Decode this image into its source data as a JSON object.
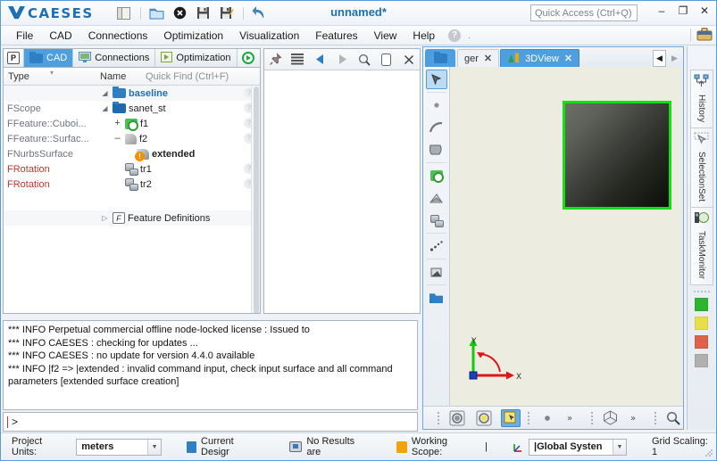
{
  "window": {
    "title": "unnamed*",
    "quick_access_placeholder": "Quick Access (Ctrl+Q)",
    "minimize": "–",
    "maximize": "❐",
    "close": "✕"
  },
  "toolbar": {
    "items": [
      {
        "name": "panel-layout-icon",
        "label": ""
      },
      {
        "name": "open-folder-icon",
        "label": ""
      },
      {
        "name": "close-project-icon",
        "label": ""
      },
      {
        "name": "save-icon",
        "label": ""
      },
      {
        "name": "save-as-icon",
        "label": ""
      },
      {
        "name": "undo-icon",
        "label": ""
      }
    ]
  },
  "menubar": {
    "items": [
      "File",
      "CAD",
      "Connections",
      "Optimization",
      "Visualization",
      "Features",
      "View",
      "Help"
    ],
    "help_glyph": "?",
    "trailing_dot": "."
  },
  "tree_panel": {
    "tabs": [
      {
        "label": "P",
        "name": "tab-p",
        "active": false
      },
      {
        "label": "CAD",
        "name": "tab-cad",
        "active": true
      },
      {
        "label": "Connections",
        "name": "tab-connections",
        "active": false
      },
      {
        "label": "Optimization",
        "name": "tab-optimization",
        "active": false
      }
    ],
    "columns": {
      "type": "Type",
      "name": "Name",
      "find_placeholder": "Quick Find (Ctrl+F)"
    },
    "rows": [
      {
        "type": "",
        "label": "baseline",
        "twisty": "◢",
        "icon": "folder-icon",
        "style": "blue",
        "help": true,
        "indent": 2,
        "alt": true
      },
      {
        "type": "FScope",
        "label": "sanet_st",
        "twisty": "◢",
        "icon": "folder-dark-icon",
        "style": "plain",
        "help": true,
        "indent": 2,
        "alt": false
      },
      {
        "type": "FFeature::Cuboi...",
        "label": "f1",
        "twisty": "+",
        "icon": "feature-green-icon",
        "style": "plain",
        "help": true,
        "indent": 3,
        "alt": false
      },
      {
        "type": "FFeature::Surfac...",
        "label": "f2",
        "twisty": "–",
        "icon": "surface-gray-icon",
        "style": "plain",
        "help": true,
        "indent": 3,
        "alt": false
      },
      {
        "type": "FNurbsSurface",
        "label": "extended",
        "twisty": "",
        "icon": "surface-warning-icon",
        "style": "plain",
        "help": false,
        "indent": 4,
        "alt": false
      },
      {
        "type": "FRotation",
        "label": "tr1",
        "twisty": "",
        "icon": "rotation-icon",
        "style": "red-type",
        "help": true,
        "indent": 4,
        "alt": false
      },
      {
        "type": "FRotation",
        "label": "tr2",
        "twisty": "",
        "icon": "rotation-icon",
        "style": "red-type",
        "help": true,
        "indent": 4,
        "alt": false
      },
      {
        "type": "",
        "label": "Feature Definitions",
        "twisty": "▷",
        "icon": "feature-definitions-icon",
        "style": "plain",
        "help": false,
        "indent": 3,
        "alt": true
      }
    ]
  },
  "prop_panel": {
    "toolbar_icons": [
      "pin-icon",
      "list-icon",
      "back-arrow-icon",
      "forward-arrow-icon",
      "search-icon",
      "copy-icon",
      "close-icon"
    ]
  },
  "log": {
    "lines": [
      "*** INFO Perpetual commercial offline node-locked license : Issued to",
      "*** INFO CAESES : checking for updates ...",
      "*** INFO CAESES : no update for version 4.4.0 available",
      "*** INFO |f2 => |extended : invalid command input, check input surface and all command parameters [extended surface creation]"
    ],
    "prompt": ">"
  },
  "view": {
    "tabs": [
      {
        "label": "ɡer",
        "name": "tab-manager",
        "active": false,
        "close": "✕"
      },
      {
        "label": "3DView",
        "name": "tab-3dview",
        "active": true,
        "close": "✕"
      }
    ],
    "nav_prev": "◀",
    "nav_next": "▶",
    "left_tools": [
      "cursor-select-icon",
      "point-icon",
      "curve-icon",
      "surface-icon",
      "feature-icon",
      "mesh-icon",
      "transform-icon",
      "particles-icon",
      "solid-icon",
      "folder-icon"
    ],
    "bottom_tools": [
      "shaded-view-icon",
      "highlight-view-icon",
      "pick-mode-icon",
      "point-size-icon",
      "more-display-icon",
      "orientation-cube-icon",
      "more-view-icon",
      "zoom-icon"
    ],
    "axis_x": "X",
    "axis_y": "Y"
  },
  "right_dock": {
    "tabs": [
      {
        "label": "History",
        "name": "dock-history",
        "icon": "history-icon"
      },
      {
        "label": "SelectionSet",
        "name": "dock-selectionset",
        "icon": "selection-icon"
      },
      {
        "label": "TaskMonitor",
        "name": "dock-taskmonitor",
        "icon": "task-monitor-icon"
      }
    ],
    "swatches": [
      "#2db52d",
      "#e8dd4a",
      "#e0614a",
      "#b0b0b0"
    ]
  },
  "statusbar": {
    "units_label": "Project Units:",
    "units_value": "meters",
    "current_design": "Current Desigr",
    "results": "No Results are",
    "working_scope_label": "Working Scope:",
    "working_scope_value": "|",
    "system_value": "|Global Systen",
    "grid_scaling": "Grid Scaling: 1"
  },
  "colors": {
    "accent": "#1f6fb5",
    "tab_active": "#4e9fe0",
    "surface_outline": "#11e011",
    "warning": "#f39200",
    "error_text": "#c0392b"
  }
}
